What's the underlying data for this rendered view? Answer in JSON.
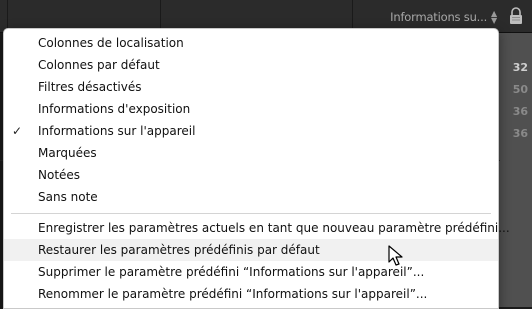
{
  "toolbar": {
    "filter_label": "Informations su...",
    "arrow_up": "▲",
    "arrow_down": "▼",
    "lock_icon": "lock-icon"
  },
  "background": {
    "visible_numbers": [
      "32",
      "50",
      "36",
      "36"
    ]
  },
  "menu": {
    "items": [
      {
        "label": "Colonnes de localisation",
        "checked": false
      },
      {
        "label": "Colonnes par défaut",
        "checked": false
      },
      {
        "label": "Filtres désactivés",
        "checked": false
      },
      {
        "label": "Informations d'exposition",
        "checked": false
      },
      {
        "label": "Informations sur l'appareil",
        "checked": true
      },
      {
        "label": "Marquées",
        "checked": false
      },
      {
        "label": "Notées",
        "checked": false
      },
      {
        "label": "Sans note",
        "checked": false
      }
    ],
    "check_mark": "✓",
    "actions": [
      {
        "label": "Enregistrer les paramètres actuels en tant que nouveau paramètre prédéfini..."
      },
      {
        "label": "Restaurer les paramètres prédéfinis par défaut",
        "hovered": true
      },
      {
        "label": "Supprimer le paramètre prédéfini “Informations sur l'appareil”..."
      },
      {
        "label": "Renommer le paramètre prédéfini “Informations sur l'appareil”..."
      }
    ]
  },
  "colors": {
    "menu_background": "#ffffff",
    "hover_background": "#f1f1f1",
    "app_dark": "#2b2b2b"
  }
}
